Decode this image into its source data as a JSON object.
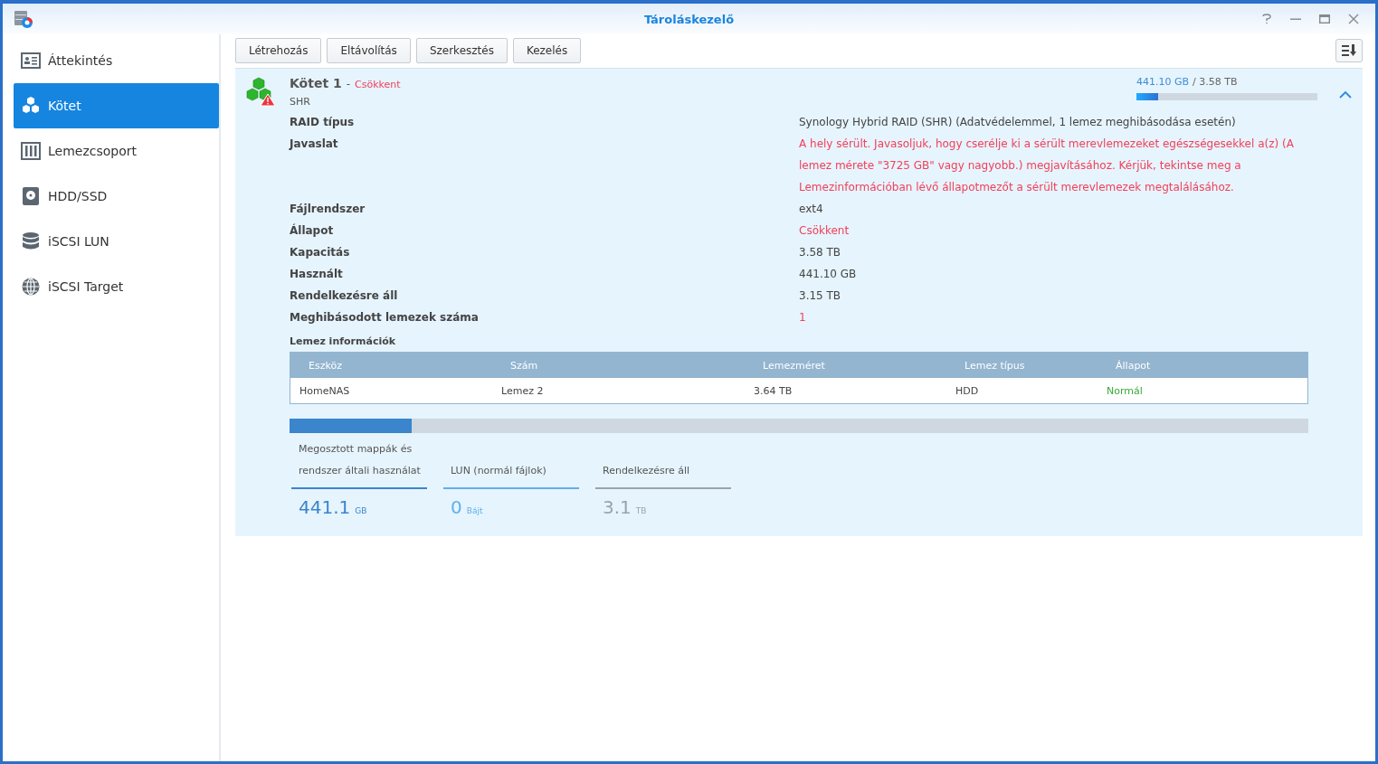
{
  "window": {
    "title": "Tároláskezelő"
  },
  "sidebar": {
    "items": [
      {
        "label": "Áttekintés",
        "kind": "overview",
        "selected": false
      },
      {
        "label": "Kötet",
        "kind": "cubes",
        "selected": true
      },
      {
        "label": "Lemezcsoport",
        "kind": "group",
        "selected": false
      },
      {
        "label": "HDD/SSD",
        "kind": "disk",
        "selected": false
      },
      {
        "label": "iSCSI LUN",
        "kind": "stack",
        "selected": false
      },
      {
        "label": "iSCSI Target",
        "kind": "globe",
        "selected": false
      }
    ]
  },
  "toolbar": {
    "buttons": [
      "Létrehozás",
      "Eltávolítás",
      "Szerkesztés",
      "Kezelés"
    ]
  },
  "volume": {
    "name": "Kötet 1",
    "separator": "-",
    "status": "Csökkent",
    "raid": "SHR",
    "usage_text": "441.10 GB",
    "total_text": "/ 3.58 TB",
    "level": 0.12,
    "expanded": true,
    "properties": [
      {
        "label": "RAID típus",
        "value": "Synology Hybrid RAID (SHR) (Adatvédelemmel, 1 lemez meghibásodása esetén)",
        "kind": "plain"
      },
      {
        "label": "Javaslat",
        "value": "A hely sérült. Javasoljuk, hogy cserélje ki a sérült merevlemezeket egészségesekkel a(z) (A lemez mérete \"3725 GB\" vagy nagyobb.) megjavításához. Kérjük, tekintse meg a Lemezinformációban lévő állapotmezőt a sérült merevlemezek megtalálásához.",
        "kind": "alert"
      },
      {
        "label": "Fájlrendszer",
        "value": "ext4",
        "kind": "plain"
      },
      {
        "label": "Állapot",
        "value": "Csökkent",
        "kind": "alert"
      },
      {
        "label": "Kapacitás",
        "value": "3.58 TB",
        "kind": "plain"
      },
      {
        "label": "Használt",
        "value": "441.10 GB",
        "kind": "plain"
      },
      {
        "label": "Rendelkezésre áll",
        "value": "3.15 TB",
        "kind": "plain"
      },
      {
        "label": "Meghibásodott lemezek száma",
        "value": "1",
        "kind": "alert"
      }
    ],
    "disk_info": {
      "title": "Lemez információk",
      "columns": [
        "Eszköz",
        "Szám",
        "Lemezméret",
        "Lemez típus",
        "Állapot"
      ],
      "rows": [
        {
          "cells": [
            "HomeNAS",
            "Lemez 2",
            "3.64 TB",
            "HDD",
            "Normál"
          ],
          "kind": "ok"
        }
      ]
    },
    "usage_bar": {
      "level": 0.12
    },
    "legend": [
      {
        "label": "Megosztott mappák és rendszer általi használat",
        "value": "441.1",
        "unit": "GB",
        "color": "#3a85cc"
      },
      {
        "label": "LUN (normál fájlok)",
        "value": "0",
        "unit": "Bájt",
        "color": "#5fb0ea"
      },
      {
        "label": "Rendelkezésre áll",
        "value": "3.1",
        "unit": "TB",
        "color": "#9aa3ab"
      }
    ]
  }
}
